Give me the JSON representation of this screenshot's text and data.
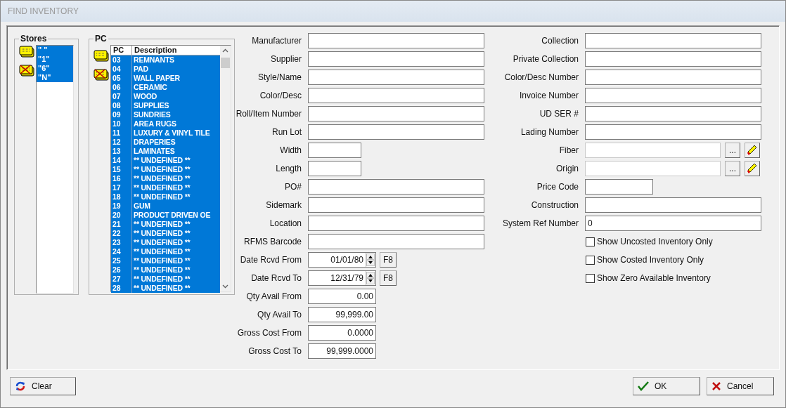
{
  "window": {
    "title": "FIND INVENTORY"
  },
  "stores": {
    "title": "Stores",
    "items": [
      {
        "label": "\" \"",
        "selected": true
      },
      {
        "label": "\"1\"",
        "selected": true
      },
      {
        "label": "\"6\"",
        "selected": true
      },
      {
        "label": "\"N\"",
        "selected": true
      }
    ]
  },
  "pc": {
    "title": "PC",
    "columns": [
      "PC",
      "Description"
    ],
    "rows": [
      {
        "pc": "03",
        "description": "REMNANTS",
        "selected": true
      },
      {
        "pc": "04",
        "description": "PAD",
        "selected": true
      },
      {
        "pc": "05",
        "description": "WALL PAPER",
        "selected": true
      },
      {
        "pc": "06",
        "description": "CERAMIC",
        "selected": true
      },
      {
        "pc": "07",
        "description": "WOOD",
        "selected": true
      },
      {
        "pc": "08",
        "description": "SUPPLIES",
        "selected": true
      },
      {
        "pc": "09",
        "description": "SUNDRIES",
        "selected": true
      },
      {
        "pc": "10",
        "description": "AREA RUGS",
        "selected": true
      },
      {
        "pc": "11",
        "description": "LUXURY & VINYL TILE",
        "selected": true
      },
      {
        "pc": "12",
        "description": "DRAPERIES",
        "selected": true
      },
      {
        "pc": "13",
        "description": "LAMINATES",
        "selected": true
      },
      {
        "pc": "14",
        "description": "** UNDEFINED **",
        "selected": true
      },
      {
        "pc": "15",
        "description": "** UNDEFINED **",
        "selected": true
      },
      {
        "pc": "16",
        "description": "** UNDEFINED **",
        "selected": true
      },
      {
        "pc": "17",
        "description": "** UNDEFINED **",
        "selected": true
      },
      {
        "pc": "18",
        "description": "** UNDEFINED **",
        "selected": true
      },
      {
        "pc": "19",
        "description": "GUM",
        "selected": true
      },
      {
        "pc": "20",
        "description": "PRODUCT DRIVEN OE",
        "selected": true
      },
      {
        "pc": "21",
        "description": "** UNDEFINED **",
        "selected": true
      },
      {
        "pc": "22",
        "description": "** UNDEFINED **",
        "selected": true
      },
      {
        "pc": "23",
        "description": "** UNDEFINED **",
        "selected": true
      },
      {
        "pc": "24",
        "description": "** UNDEFINED **",
        "selected": true
      },
      {
        "pc": "25",
        "description": "** UNDEFINED **",
        "selected": true
      },
      {
        "pc": "26",
        "description": "** UNDEFINED **",
        "selected": true
      },
      {
        "pc": "27",
        "description": "** UNDEFINED **",
        "selected": true
      },
      {
        "pc": "28",
        "description": "** UNDEFINED **",
        "selected": true
      }
    ]
  },
  "left_fields": [
    {
      "label": "Manufacturer",
      "kind": "text"
    },
    {
      "label": "Supplier",
      "kind": "text"
    },
    {
      "label": "Style/Name",
      "kind": "text"
    },
    {
      "label": "Color/Desc",
      "kind": "text"
    },
    {
      "label": "Roll/Item Number",
      "kind": "text"
    },
    {
      "label": "Run Lot",
      "kind": "text"
    },
    {
      "label": "Width",
      "kind": "short"
    },
    {
      "label": "Length",
      "kind": "short"
    },
    {
      "label": "PO#",
      "kind": "text"
    },
    {
      "label": "Sidemark",
      "kind": "text"
    },
    {
      "label": "Location",
      "kind": "text"
    },
    {
      "label": "RFMS Barcode",
      "kind": "text"
    },
    {
      "label": "Date Rcvd From",
      "kind": "date",
      "value": "01/01/80",
      "button": "F8"
    },
    {
      "label": "Date Rcvd To",
      "kind": "date",
      "value": "12/31/79",
      "button": "F8"
    },
    {
      "label": "Qty Avail From",
      "kind": "number",
      "value": "0.00"
    },
    {
      "label": "Qty Avail To",
      "kind": "number",
      "value": "99,999.00"
    },
    {
      "label": "Gross Cost From",
      "kind": "number",
      "value": "0.0000"
    },
    {
      "label": "Gross Cost To",
      "kind": "number",
      "value": "99,999.0000"
    }
  ],
  "right_fields": [
    {
      "label": "Collection",
      "kind": "text"
    },
    {
      "label": "Private Collection",
      "kind": "text"
    },
    {
      "label": "Color/Desc Number",
      "kind": "text"
    },
    {
      "label": "Invoice Number",
      "kind": "text"
    },
    {
      "label": "UD SER #",
      "kind": "text"
    },
    {
      "label": "Lading Number",
      "kind": "text"
    },
    {
      "label": "Fiber",
      "kind": "lookup",
      "button": "..."
    },
    {
      "label": "Origin",
      "kind": "lookup",
      "button": "..."
    },
    {
      "label": "Price Code",
      "kind": "number"
    },
    {
      "label": "Construction",
      "kind": "text"
    },
    {
      "label": "System Ref Number",
      "kind": "text",
      "value": "0"
    }
  ],
  "checkboxes": [
    {
      "label": "Show Uncosted Inventory Only",
      "checked": false
    },
    {
      "label": "Show Costed Inventory Only",
      "checked": false
    },
    {
      "label": "Show Zero Available Inventory",
      "checked": false
    }
  ],
  "buttons": {
    "clear": "Clear",
    "ok": "OK",
    "cancel": "Cancel"
  }
}
